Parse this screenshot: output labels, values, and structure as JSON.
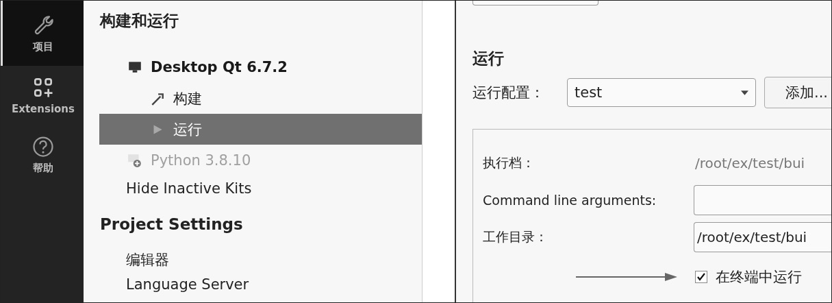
{
  "activity_bar": [
    {
      "label": "项目",
      "kind": "wrench",
      "selected": true
    },
    {
      "label": "Extensions",
      "kind": "extensions",
      "selected": false
    },
    {
      "label": "帮助",
      "kind": "help",
      "selected": false
    }
  ],
  "tree": {
    "title": "构建和运行",
    "kits": [
      {
        "label": "Desktop Qt 6.7.2",
        "kind": "desktop",
        "disabled": false,
        "children": [
          {
            "label": "构建",
            "kind": "build",
            "selected": false
          },
          {
            "label": "运行",
            "kind": "run",
            "selected": true
          }
        ]
      },
      {
        "label": "Python 3.8.10",
        "kind": "python",
        "disabled": true
      }
    ],
    "hide_inactive": "Hide Inactive Kits"
  },
  "project_settings": {
    "title": "Project Settings",
    "items": [
      "编辑器",
      "Language Server"
    ]
  },
  "run": {
    "title": "运行",
    "config_label": "运行配置：",
    "config_value": "test",
    "add_button": "添加...",
    "executable_label": "执行档：",
    "executable_value": "/root/ex/test/bui",
    "args_label": "Command line arguments:",
    "workdir_label": "工作目录：",
    "workdir_value": "/root/ex/test/bui",
    "terminal": {
      "label": "在终端中运行",
      "checked": true
    }
  }
}
